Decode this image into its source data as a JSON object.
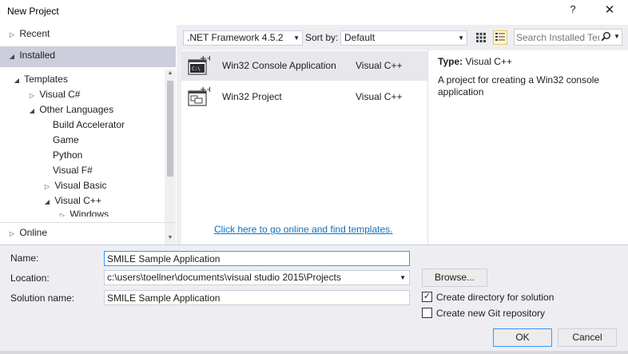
{
  "window": {
    "title": "New Project",
    "help_glyph": "?",
    "close_glyph": "✕"
  },
  "tree": {
    "recent": "Recent",
    "installed": "Installed",
    "items": [
      {
        "label": "Templates",
        "arrow": "◢"
      },
      {
        "label": "Visual C#",
        "arrow": "▷"
      },
      {
        "label": "Other Languages",
        "arrow": "◢"
      },
      {
        "label": "Build Accelerator",
        "arrow": ""
      },
      {
        "label": "Game",
        "arrow": ""
      },
      {
        "label": "Python",
        "arrow": ""
      },
      {
        "label": "Visual F#",
        "arrow": ""
      },
      {
        "label": "Visual Basic",
        "arrow": "▷"
      },
      {
        "label": "Visual C++",
        "arrow": "◢"
      },
      {
        "label": "Windows",
        "arrow": "▷"
      }
    ],
    "online": "Online"
  },
  "toolbar": {
    "framework": ".NET Framework 4.5.2",
    "sort_label": "Sort by:",
    "sort_value": "Default",
    "search_placeholder": "Search Installed Templates"
  },
  "templates": [
    {
      "name": "Win32 Console Application",
      "lang": "Visual C++",
      "selected": true
    },
    {
      "name": "Win32 Project",
      "lang": "Visual C++",
      "selected": false
    }
  ],
  "online_link": "Click here to go online and find templates.",
  "details": {
    "type_label": "Type:",
    "type_value": "Visual C++",
    "description": "A project for creating a Win32 console application"
  },
  "form": {
    "name_label": "Name:",
    "name_value": "SMILE Sample Application",
    "location_label": "Location:",
    "location_value": "c:\\users\\toellner\\documents\\visual studio 2015\\Projects",
    "solution_label": "Solution name:",
    "solution_value": "SMILE Sample Application",
    "browse": "Browse...",
    "create_dir": "Create directory for solution",
    "create_dir_checked": true,
    "create_git": "Create new Git repository",
    "create_git_checked": false,
    "ok": "OK",
    "cancel": "Cancel"
  },
  "colors": {
    "accent": "#3399ff",
    "selection": "#cccedb",
    "link": "#0e70c0",
    "panel": "#eeeef2"
  }
}
